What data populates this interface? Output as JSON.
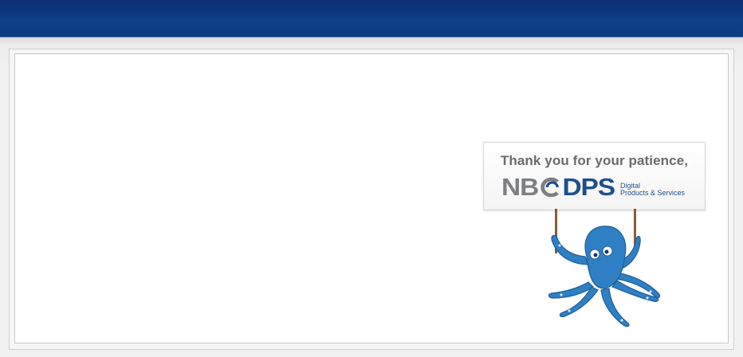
{
  "header": {
    "bar_color": "#0d3a7e"
  },
  "sign": {
    "message": "Thank you for your patience,",
    "logo": {
      "letters_gray": "NB",
      "letters_blue": "DPS",
      "tagline_line1": "Digital",
      "tagline_line2": "Products & Services",
      "gray_color": "#7d7f82",
      "blue_color": "#1d4f8d"
    }
  },
  "mascot": {
    "icon": "octopus-icon",
    "color": "#2f7fc4"
  }
}
